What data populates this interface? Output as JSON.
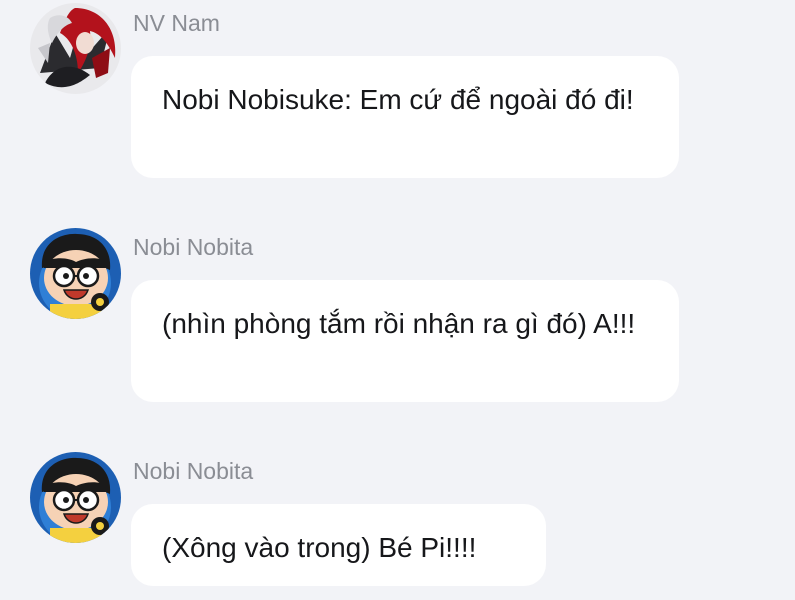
{
  "messages": [
    {
      "sender": "NV Nam",
      "avatar": "red-haired-character-avatar",
      "text": "Nobi Nobisuke: Em cứ để ngoài đó đi!"
    },
    {
      "sender": "Nobi Nobita",
      "avatar": "nobita-avatar",
      "text": "(nhìn phòng tắm rồi nhận ra gì đó) A!!!"
    },
    {
      "sender": "Nobi Nobita",
      "avatar": "nobita-avatar",
      "text": "(Xông vào trong) Bé Pi!!!!"
    }
  ],
  "colors": {
    "background": "#f2f3f7",
    "bubble": "#ffffff",
    "sender_text": "#8a8d94",
    "message_text": "#16171a"
  }
}
